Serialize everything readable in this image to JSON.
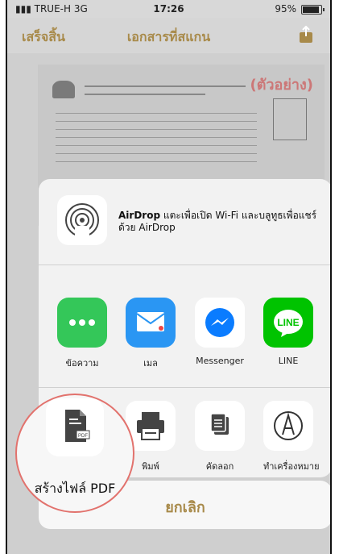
{
  "status_bar": {
    "carrier": "TRUE-H",
    "network": "3G",
    "time": "17:26",
    "battery": "95%"
  },
  "nav": {
    "done_label": "เสร็จสิ้น",
    "title": "เอกสารที่สแกน"
  },
  "document": {
    "stamp_text": "(ตัวอย่าง)"
  },
  "share_sheet": {
    "airdrop": {
      "title": "AirDrop",
      "desc": "แตะเพื่อเปิด Wi-Fi และบลูทูธเพื่อแชร์ด้วย AirDrop"
    },
    "apps": [
      {
        "label": "ข้อความ",
        "icon": "messages-icon",
        "color": "#34c759"
      },
      {
        "label": "เมล",
        "icon": "mail-icon",
        "color": "#2a96f3"
      },
      {
        "label": "Messenger",
        "icon": "messenger-icon",
        "color": "#0a7cff"
      },
      {
        "label": "LINE",
        "icon": "line-icon",
        "color": "#00c300"
      }
    ],
    "actions": [
      {
        "label": "สร้างไฟล์ PDF",
        "icon": "pdf-file-icon"
      },
      {
        "label": "พิมพ์",
        "icon": "printer-icon"
      },
      {
        "label": "คัดลอก",
        "icon": "copy-icon"
      },
      {
        "label": "ทำเครื่องหมาย",
        "icon": "markup-icon"
      }
    ],
    "cancel_label": "ยกเลิก"
  },
  "colors": {
    "accent": "#a88a4a",
    "callout_outline": "#e2726d"
  }
}
